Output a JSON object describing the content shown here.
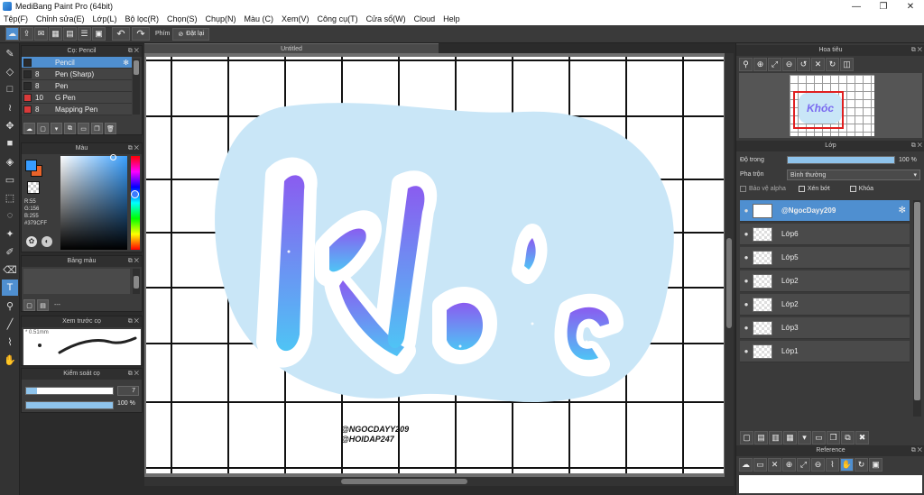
{
  "window": {
    "title": "MediBang Paint Pro (64bit)",
    "minimize": "—",
    "restore": "❐",
    "close": "✕"
  },
  "menu": [
    "Tệp(F)",
    "Chỉnh sửa(E)",
    "Lớp(L)",
    "Bộ lọc(R)",
    "Chọn(S)",
    "Chụp(N)",
    "Màu (C)",
    "Xem(V)",
    "Công cụ(T)",
    "Cửa sổ(W)",
    "Cloud",
    "Help"
  ],
  "toolbar": {
    "label": "Phím",
    "reset": "Đặt lại",
    "undo": "↶",
    "redo": "↷"
  },
  "brush_panel": {
    "title": "Cọ: Pencil",
    "brushes": [
      {
        "size": "",
        "name": "Pencil",
        "color": "#2a2a2a"
      },
      {
        "size": "8",
        "name": "Pen (Sharp)",
        "color": "#2a2a2a"
      },
      {
        "size": "8",
        "name": "Pen",
        "color": "#2a2a2a"
      },
      {
        "size": "10",
        "name": "G Pen",
        "color": "#d93a3a"
      },
      {
        "size": "8",
        "name": "Mapping Pen",
        "color": "#d93a3a"
      }
    ]
  },
  "color_panel": {
    "title": "Màu",
    "r": "R:55",
    "g": "G:156",
    "b": "B:255",
    "hex": "#379CFF",
    "fg": "#379CFF",
    "bg": "#E8632A"
  },
  "palette_panel": {
    "title": "Bảng màu",
    "dots": "---"
  },
  "preview_panel": {
    "title": "Xem trước cọ",
    "size": "0.51mm"
  },
  "control_panel": {
    "title": "Kiểm soát cọ",
    "size_value": "7",
    "opacity_value": "100 %"
  },
  "document": {
    "tab": "Untitled"
  },
  "canvas": {
    "art_text": "Khóc",
    "watermark1": "@NGOCDAYY209",
    "watermark2": "@HOIDAP247",
    "art_color_top": "#8a5cf0",
    "art_color_bottom": "#4fc4f5",
    "blob_color": "#c9e6f7"
  },
  "navigator": {
    "title": "Hoa tiêu"
  },
  "layer_panel": {
    "title": "Lớp",
    "opacity_label": "Độ trong",
    "opacity_value": "100 %",
    "blend_label": "Pha trộn",
    "blend_value": "Bình thường",
    "protect_alpha": "Bảo vệ alpha",
    "clipping": "Xén bớt",
    "lock": "Khóa",
    "layers": [
      {
        "name": "@NgocDayy209",
        "selected": true
      },
      {
        "name": "Lớp6",
        "selected": false
      },
      {
        "name": "Lớp5",
        "selected": false
      },
      {
        "name": "Lớp2",
        "selected": false
      },
      {
        "name": "Lớp2",
        "selected": false
      },
      {
        "name": "Lớp3",
        "selected": false
      },
      {
        "name": "Lớp1",
        "selected": false
      }
    ]
  },
  "reference_panel": {
    "title": "Reference"
  }
}
